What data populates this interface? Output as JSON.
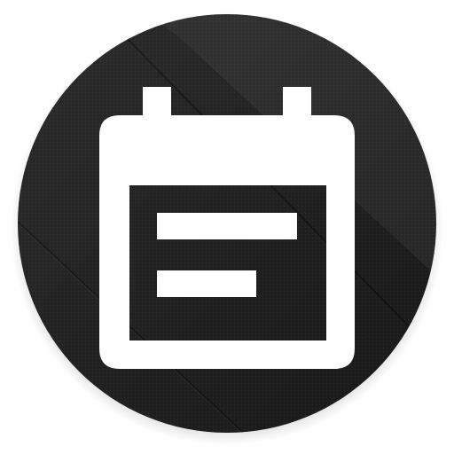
{
  "app_icon": {
    "icon": "calendar-icon",
    "colors": {
      "background_dark": "#1c1c1c",
      "background_mid": "#2a2a2a",
      "background_light": "#3a3a3a",
      "glyph": "#ffffff"
    }
  }
}
